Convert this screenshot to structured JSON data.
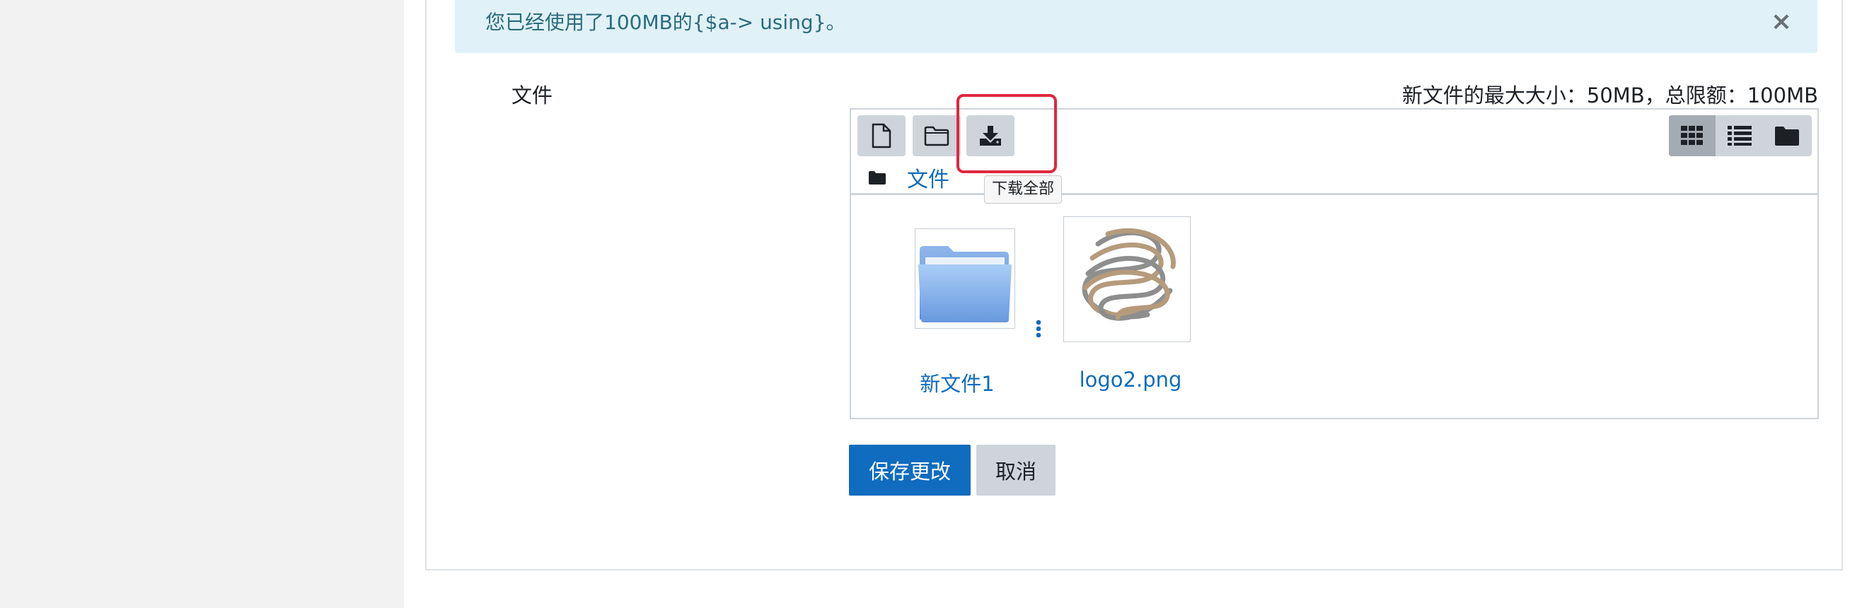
{
  "alert": {
    "message": "您已经使用了100MB的{$a-> using}。",
    "close_symbol": "×"
  },
  "form": {
    "field_label": "文件",
    "limits": "新文件的最大大小：50MB，总限额：100MB"
  },
  "filemanager": {
    "toolbar": {
      "add_file_icon": "file-add-icon",
      "create_folder_icon": "folder-create-icon",
      "download_all_icon": "download-icon",
      "download_all_tooltip": "下载全部"
    },
    "views": [
      {
        "icon": "grid-icon",
        "active": true
      },
      {
        "icon": "list-icon",
        "active": false
      },
      {
        "icon": "folder-tree-icon",
        "active": false
      }
    ],
    "path": {
      "icon": "folder-icon",
      "label": "文件"
    },
    "items": [
      {
        "name": "新文件1",
        "type": "folder"
      },
      {
        "name": "logo2.png",
        "type": "image"
      }
    ]
  },
  "buttons": {
    "save": "保存更改",
    "cancel": "取消"
  },
  "colors": {
    "primary": "#0f6cbf",
    "alert_bg": "#e0f2f7",
    "highlight": "#e0273e",
    "button_gray": "#ced4da"
  }
}
